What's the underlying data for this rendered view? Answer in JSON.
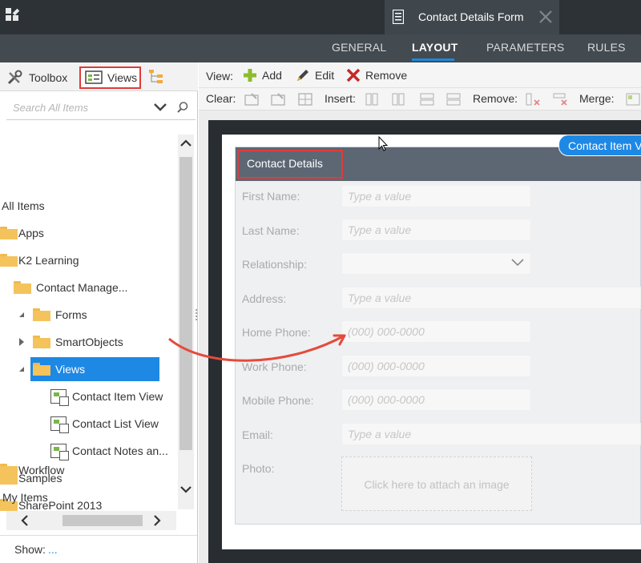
{
  "topbar": {
    "document_tab_title": "Contact Details Form"
  },
  "subnav": {
    "tabs": [
      {
        "label": "GENERAL",
        "active": false
      },
      {
        "label": "LAYOUT",
        "active": true
      },
      {
        "label": "PARAMETERS",
        "active": false
      },
      {
        "label": "RULES",
        "active": false
      }
    ]
  },
  "left_panel": {
    "tabs": {
      "toolbox": "Toolbox",
      "views": "Views"
    },
    "search_placeholder": "Search All Items",
    "tree": [
      {
        "label": "All Items",
        "type": "root"
      },
      {
        "label": "Apps",
        "type": "folder"
      },
      {
        "label": "K2 Learning",
        "type": "folder"
      },
      {
        "label": "Contact Manage...",
        "type": "folder",
        "expanded": true
      },
      {
        "label": "Forms",
        "type": "folder",
        "expanded": true
      },
      {
        "label": "SmartObjects",
        "type": "folder",
        "expanded": false
      },
      {
        "label": "Views",
        "type": "folder",
        "expanded": true,
        "selected": true
      },
      {
        "label": "Contact Item View",
        "type": "view"
      },
      {
        "label": "Contact List View",
        "type": "view"
      },
      {
        "label": "Contact Notes an...",
        "type": "view"
      },
      {
        "label": "Samples",
        "type": "folder"
      },
      {
        "label": "SharePoint 2013",
        "type": "folder"
      },
      {
        "label": "Workflow",
        "type": "folder"
      },
      {
        "label": "My Items",
        "type": "root"
      }
    ],
    "show_label": "Show:",
    "show_value": "..."
  },
  "toolbar": {
    "view_label": "View:",
    "add": "Add",
    "edit": "Edit",
    "remove": "Remove",
    "clear_label": "Clear:",
    "insert_label": "Insert:",
    "remove_label": "Remove:",
    "merge_label": "Merge:"
  },
  "canvas": {
    "view_badge": "Contact Item View",
    "section_title": "Contact Details",
    "fields": [
      {
        "label": "First Name:",
        "placeholder": "Type a value"
      },
      {
        "label": "Last Name:",
        "placeholder": "Type a value"
      },
      {
        "label": "Relationship:",
        "placeholder": ""
      },
      {
        "label": "Address:",
        "placeholder": "Type a value"
      },
      {
        "label": "Home Phone:",
        "placeholder": "(000) 000-0000"
      },
      {
        "label": "Work Phone:",
        "placeholder": "(000) 000-0000"
      },
      {
        "label": "Mobile Phone:",
        "placeholder": "(000) 000-0000"
      },
      {
        "label": "Email:",
        "placeholder": "Type a value"
      },
      {
        "label": "Photo:",
        "placeholder": ""
      }
    ],
    "attach_text": "Click here to attach an image"
  },
  "colors": {
    "topbar": "#2d3236",
    "subnav": "#434a50",
    "accent": "#1e88e5",
    "highlight": "#e03b3b",
    "view_header": "#5d6774"
  }
}
